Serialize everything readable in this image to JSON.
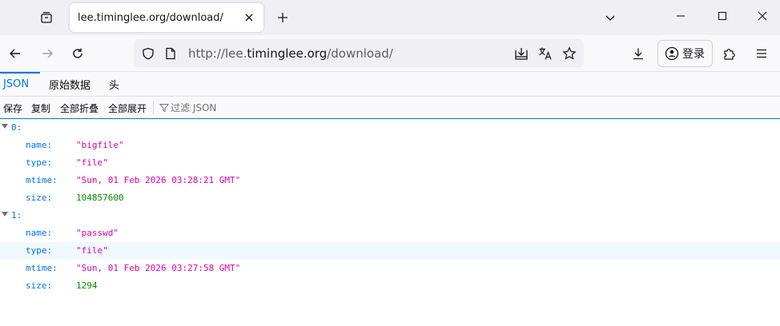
{
  "browser": {
    "tab_title": "lee.timinglee.org/download/",
    "url_prefix": "http://lee.",
    "url_host": "timinglee.org",
    "url_path": "/download/",
    "login_label": "登录"
  },
  "viewer": {
    "tabs": [
      "JSON",
      "原始数据",
      "头"
    ],
    "toolbar": {
      "save": "保存",
      "copy": "复制",
      "collapse_all": "全部折叠",
      "expand_all": "全部展开",
      "filter_placeholder": "过滤 JSON"
    }
  },
  "json": {
    "items": [
      {
        "index": "0:",
        "fields": [
          {
            "key": "name:",
            "value": "\"bigfile\"",
            "kind": "string"
          },
          {
            "key": "type:",
            "value": "\"file\"",
            "kind": "string"
          },
          {
            "key": "mtime:",
            "value": "\"Sun, 01 Feb 2026 03:28:21 GMT\"",
            "kind": "string"
          },
          {
            "key": "size:",
            "value": "104857600",
            "kind": "number"
          }
        ]
      },
      {
        "index": "1:",
        "fields": [
          {
            "key": "name:",
            "value": "\"passwd\"",
            "kind": "string"
          },
          {
            "key": "type:",
            "value": "\"file\"",
            "kind": "string"
          },
          {
            "key": "mtime:",
            "value": "\"Sun, 01 Feb 2026 03:27:58 GMT\"",
            "kind": "string"
          },
          {
            "key": "size:",
            "value": "1294",
            "kind": "number"
          }
        ]
      }
    ]
  },
  "colors": {
    "accent": "#0074e8",
    "string": "#dd00a9",
    "number": "#058b00"
  }
}
